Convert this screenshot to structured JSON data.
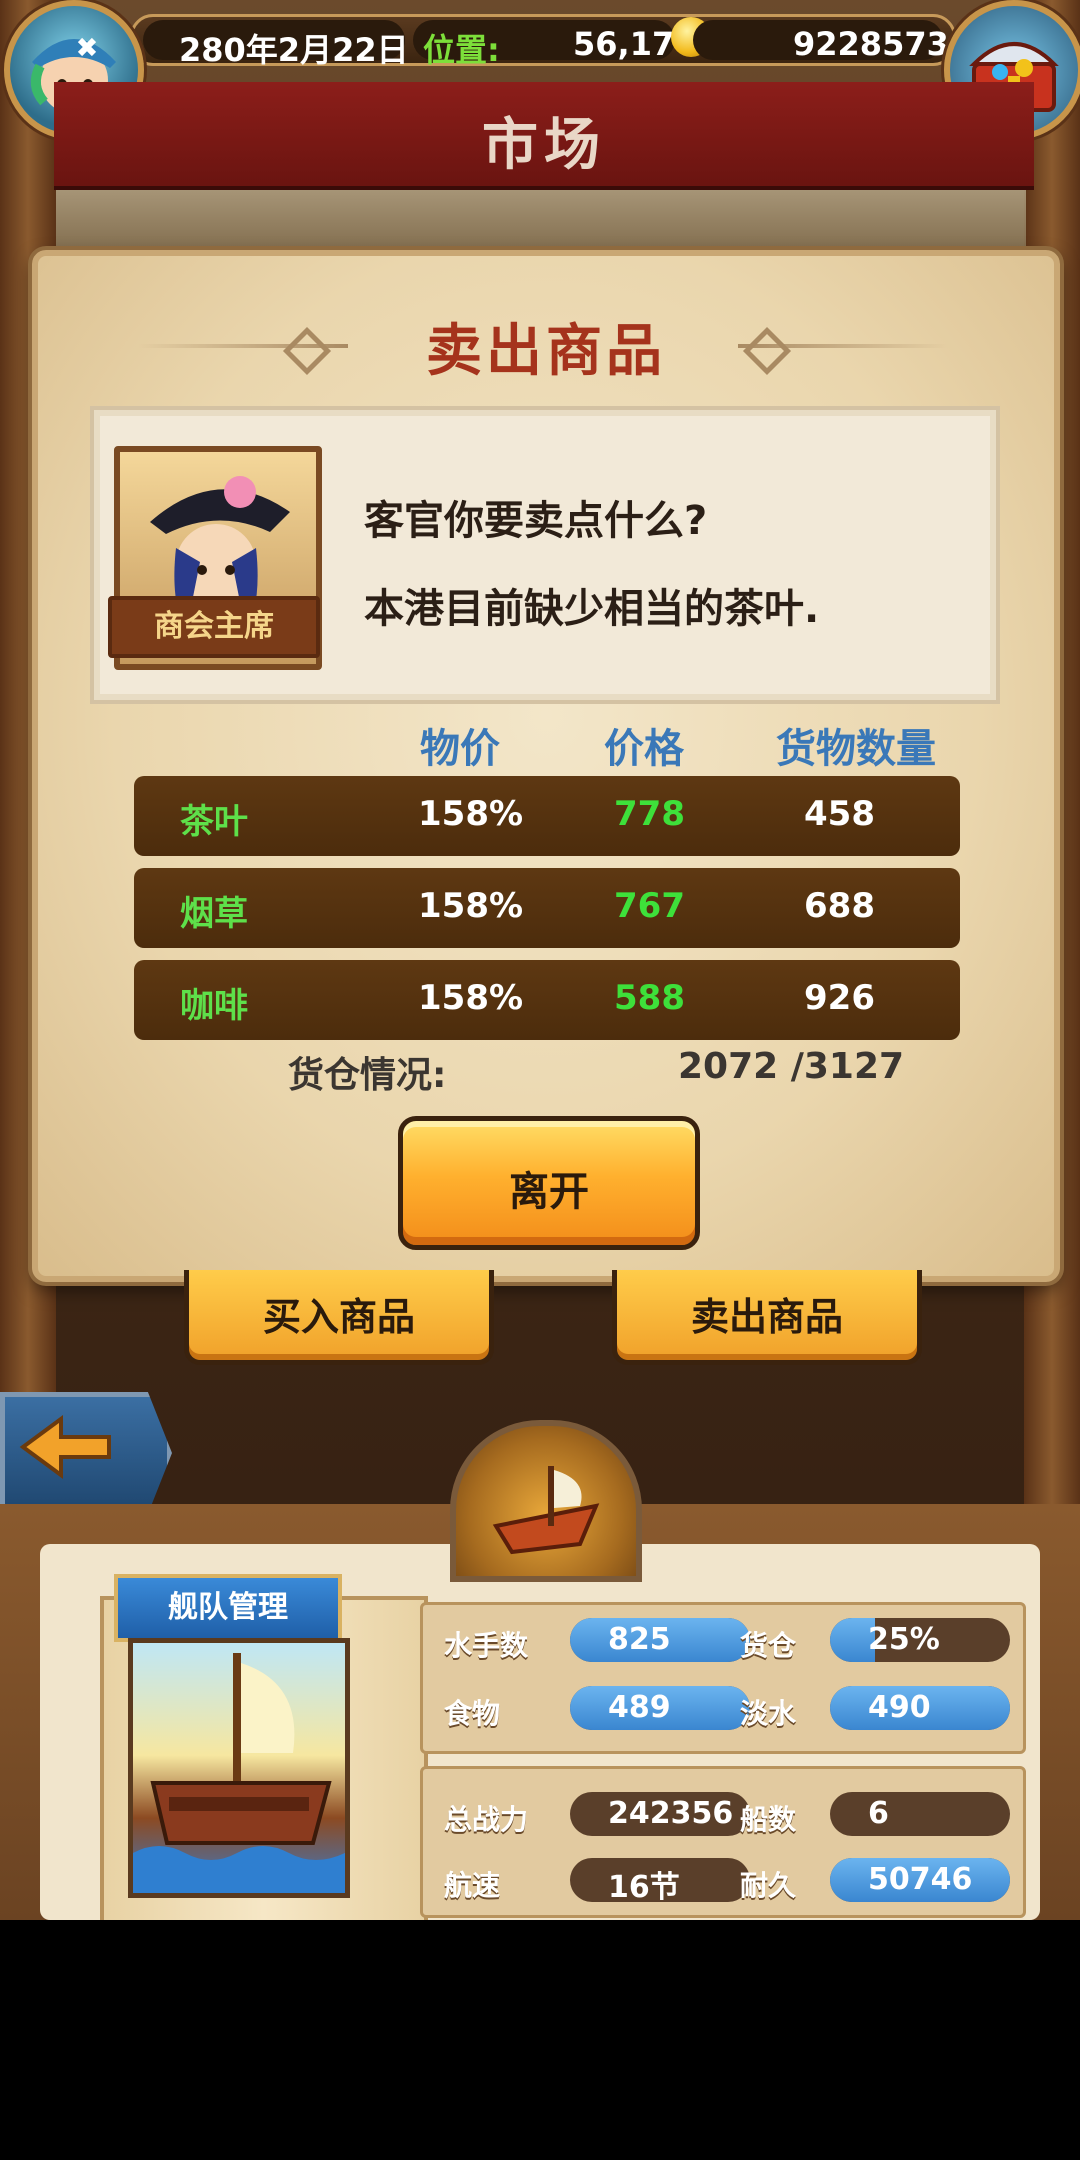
{
  "top_bar": {
    "date": "280年2月22日",
    "position_label": "位置:",
    "position_value": "56,17",
    "gold": "9228573"
  },
  "market": {
    "title": "市场"
  },
  "dialog": {
    "title": "卖出商品",
    "npc_caption": "商会主席",
    "line1": "客官你要卖点什么?",
    "line2": "本港目前缺少相当的茶叶.",
    "columns": [
      "物价",
      "价格",
      "货物数量"
    ],
    "goods": [
      {
        "name": "茶叶",
        "rate": "158%",
        "price": "778",
        "qty": "458"
      },
      {
        "name": "烟草",
        "rate": "158%",
        "price": "767",
        "qty": "688"
      },
      {
        "name": "咖啡",
        "rate": "158%",
        "price": "588",
        "qty": "926"
      }
    ],
    "hold_label": "货仓情况:",
    "hold_value": "2072 /3127",
    "leave_label": "离开"
  },
  "under_buttons": {
    "buy_label": "买入商品",
    "sell_label": "卖出商品"
  },
  "fleet": {
    "tag": "舰队管理",
    "stats": [
      {
        "label": "水手数",
        "value": "825",
        "icon": "sailor-icon",
        "fill": 1.0
      },
      {
        "label": "货仓",
        "value": "25%",
        "icon": "crate-icon",
        "fill": 0.25
      },
      {
        "label": "食物",
        "value": "489",
        "icon": "meat-icon",
        "fill": 1.0
      },
      {
        "label": "淡水",
        "value": "490",
        "icon": "water-jug-icon",
        "fill": 1.0
      },
      {
        "label": "总战力",
        "value": "242356",
        "icon": "crossed-swords-icon",
        "fill": 0.0
      },
      {
        "label": "船数",
        "value": "6",
        "icon": "ship-icon",
        "fill": 0.0
      },
      {
        "label": "航速",
        "value": "16节",
        "icon": "sail-icon",
        "fill": 0.0
      },
      {
        "label": "耐久",
        "value": "50746",
        "icon": "wreath-icon",
        "fill": 1.0
      }
    ]
  },
  "colors": {
    "goods_name": "#5ee04a",
    "price": "#3ee03a",
    "header_blue": "#3a78b8",
    "title_red": "#a5331c"
  }
}
